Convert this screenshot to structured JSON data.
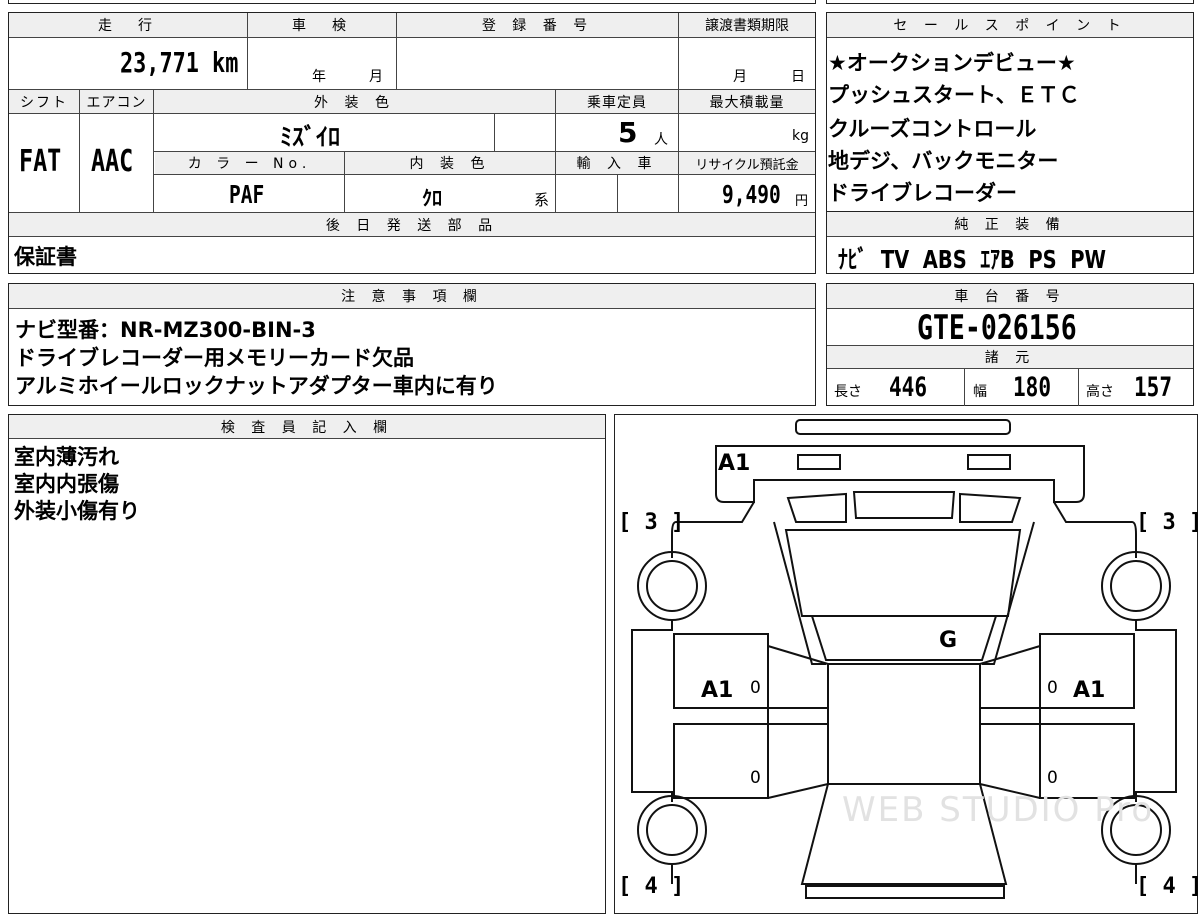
{
  "top_header": {
    "mileage_label": "走　行",
    "inspection_label": "車　検",
    "registration_label": "登 録 番 号",
    "transfer_deadline_label": "譲渡書類期限",
    "mileage_value": "23,771 km",
    "inspection_year_unit": "年",
    "inspection_month_unit": "月",
    "transfer_month_unit": "月",
    "transfer_day_unit": "日"
  },
  "specs": {
    "shift_label": "シフト",
    "aircon_label": "エアコン",
    "exterior_color_label": "外 装 色",
    "capacity_label": "乗車定員",
    "max_load_label": "最大積載量",
    "shift_value": "FAT",
    "aircon_value": "AAC",
    "exterior_color_value": "ﾐｽﾞｲﾛ",
    "capacity_value": "5",
    "capacity_unit": "人",
    "max_load_unit": "kg",
    "color_no_label": "カ ラ ー No.",
    "interior_color_label": "内 装 色",
    "import_label": "輸 入 車",
    "recycle_label": "リサイクル預託金",
    "color_no_value": "PAF",
    "interior_color_value": "ｸﾛ",
    "interior_color_suffix": "系",
    "recycle_value": "9,490",
    "recycle_unit": "円"
  },
  "later_parts": {
    "label": "後 日 発 送 部 品",
    "value": "保証書"
  },
  "sales_points": {
    "label": "セ ー ル ス ポ イ ン ト",
    "lines": [
      "★オークションデビュー★",
      "プッシュスタート、ＥＴＣ",
      "クルーズコントロール",
      "地デジ、バックモニター",
      "ドライブレコーダー"
    ]
  },
  "genuine_equipment": {
    "label": "純 正 装 備",
    "value": "ﾅﾋﾞ  TV  ABS  ｴｱB  PS  PW"
  },
  "notes": {
    "label": "注 意 事 項 欄",
    "lines": [
      "ナビ型番：NR-MZ300-BIN-3",
      "ドライブレコーダー用メモリーカード欠品",
      "アルミホイールロックナットアダプター車内に有り"
    ]
  },
  "chassis": {
    "label": "車 台 番 号",
    "value": "GTE-026156"
  },
  "dimensions": {
    "label": "諸 元",
    "length_label": "長さ",
    "length_value": "446",
    "width_label": "幅",
    "width_value": "180",
    "height_label": "高さ",
    "height_value": "157"
  },
  "inspector": {
    "label": "検 査 員 記 入 欄",
    "lines": [
      "室内薄汚れ",
      "室内内張傷",
      "外装小傷有り"
    ]
  },
  "diagram_marks": {
    "rear": "A1",
    "glass": "G",
    "left_door": "A1",
    "right_door": "A1",
    "zero": "0",
    "rear_left_tire": "[ 3 ]",
    "rear_right_tire": "[ 3 ]",
    "front_left_tire": "[ 4 ]",
    "front_right_tire": "[ 4 ]",
    "watermark": "WEB STUDIO Pro"
  }
}
